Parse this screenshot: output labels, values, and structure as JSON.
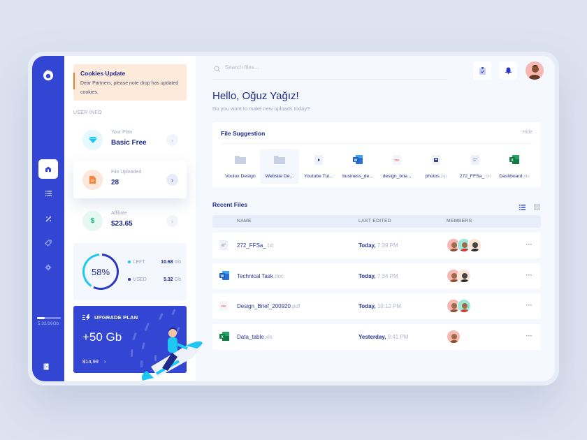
{
  "colors": {
    "primary": "#3346d3",
    "navy": "#1e2a8a",
    "accent_cyan": "#1fc8f3",
    "cookie_bg": "#fdeadb",
    "cookie_bar": "#f07b2c",
    "muted": "#a0a7bf"
  },
  "rail": {
    "logo": "drop-logo",
    "nav_items": [
      {
        "icon": "home-icon",
        "active": true
      },
      {
        "icon": "list-icon",
        "active": false
      },
      {
        "icon": "percent-icon",
        "active": false
      },
      {
        "icon": "tag-icon",
        "active": false
      },
      {
        "icon": "settings-icon",
        "active": false
      }
    ],
    "storage_fraction": 0.3325,
    "storage_text": "5.32/16Gb",
    "logout_icon": "door-icon"
  },
  "cookie": {
    "title": "Cookies Update",
    "body": "Dear Partners, please note drop has updated cookies."
  },
  "user_info": {
    "label": "USER INFO",
    "items": [
      {
        "label": "Your Plan",
        "value": "Basic Free",
        "icon": "diamond-icon"
      },
      {
        "label": "File Uploaded",
        "value": "28",
        "icon": "document-icon"
      },
      {
        "label": "Affiliate",
        "value": "$23.65",
        "icon": "dollar-icon"
      }
    ]
  },
  "usage": {
    "percent_label": "58%",
    "used_fraction": 0.58,
    "left_label": "LEFT",
    "left_value": "10.68",
    "used_label": "USED",
    "used_value": "5.32",
    "unit": "Gb"
  },
  "upgrade": {
    "title": "UPGRADE PLAN",
    "amount": "+50 Gb",
    "price": "$14,99"
  },
  "search": {
    "placeholder": "Search files..."
  },
  "header": {
    "greeting": "Hello, Oğuz Yağız!",
    "subtitle": "Do you want to make new uploads today?"
  },
  "suggestions": {
    "title": "File Suggestion",
    "hide_label": "Hide",
    "items": [
      {
        "name": "Voulux Design",
        "ext": "",
        "type": "folder"
      },
      {
        "name": "Website De...",
        "ext": "",
        "type": "folder"
      },
      {
        "name": "Youtube Tut...",
        "ext": "",
        "type": "video"
      },
      {
        "name": "business_de...",
        "ext": "",
        "type": "word"
      },
      {
        "name": "design_brie...",
        "ext": "",
        "type": "pdf"
      },
      {
        "name": "photos",
        "ext": ".zip",
        "type": "zip"
      },
      {
        "name": "272_FFSa_",
        "ext": ".txt",
        "type": "txt"
      },
      {
        "name": "Dashboard",
        "ext": ".xls",
        "type": "excel"
      }
    ]
  },
  "recent": {
    "title": "Recent Files",
    "columns": [
      "NAME",
      "LAST EDITED",
      "MEMBERS"
    ],
    "rows": [
      {
        "name": "272_FFSa_",
        "ext": ".txt",
        "type": "txt",
        "day": "Today,",
        "time": "7:39 PM",
        "members": [
          "pink",
          "teal",
          "peach"
        ]
      },
      {
        "name": "Technical Task",
        "ext": ".doc",
        "type": "word",
        "day": "Today,",
        "time": "7:34 PM",
        "members": [
          "pink",
          "peach"
        ]
      },
      {
        "name": "Design_Brief_200920",
        "ext": ".pdf",
        "type": "pdf",
        "day": "Today,",
        "time": "10:12 PM",
        "members": [
          "pink",
          "teal"
        ]
      },
      {
        "name": "Data_table",
        "ext": ".xls",
        "type": "excel",
        "day": "Yesterday,",
        "time": "9:41 PM",
        "members": [
          "pink"
        ]
      }
    ]
  }
}
